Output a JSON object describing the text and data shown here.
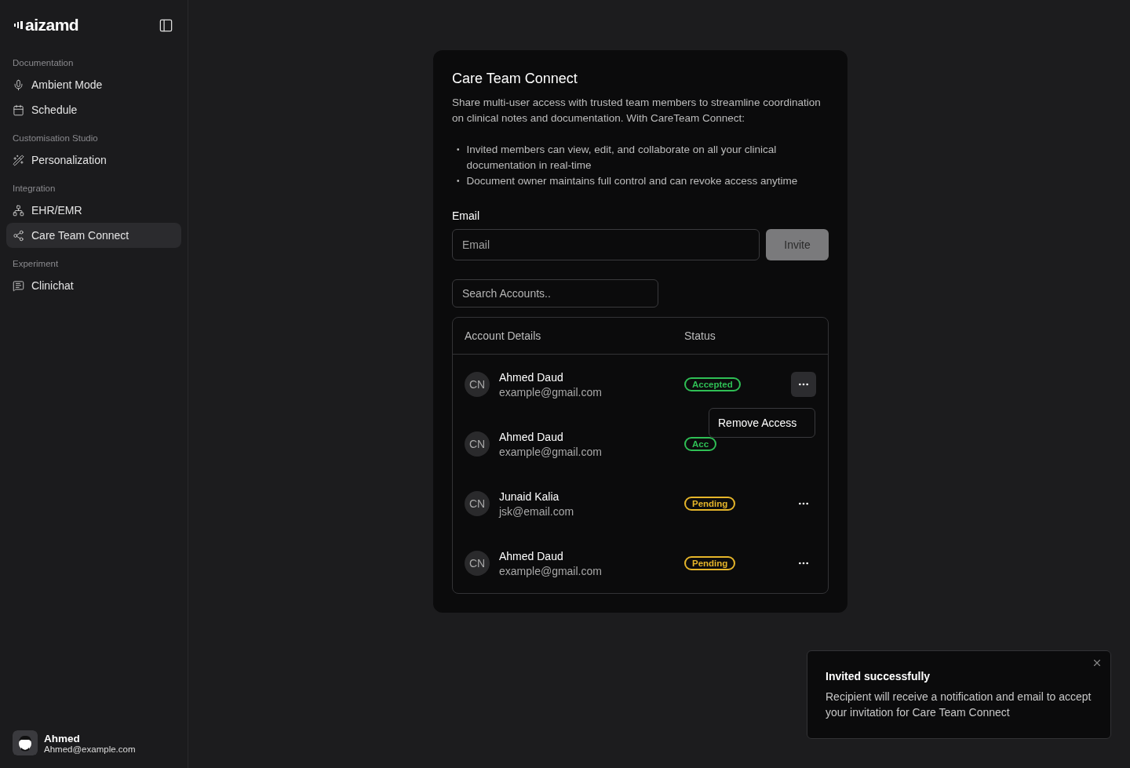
{
  "sidebar": {
    "logo": "aizamd",
    "sections": [
      {
        "title": "Documentation",
        "items": [
          {
            "label": "Ambient Mode",
            "selected": false
          },
          {
            "label": "Schedule",
            "selected": false
          }
        ]
      },
      {
        "title": "Customisation Studio",
        "items": [
          {
            "label": "Personalization",
            "selected": false
          }
        ]
      },
      {
        "title": "Integration",
        "items": [
          {
            "label": "EHR/EMR",
            "selected": false
          },
          {
            "label": "Care Team Connect",
            "selected": true
          }
        ]
      },
      {
        "title": "Experiment",
        "items": [
          {
            "label": "Clinichat",
            "selected": false
          }
        ]
      }
    ],
    "user": {
      "name": "Ahmed",
      "email": "Ahmed@example.com"
    }
  },
  "card": {
    "title": "Care Team Connect",
    "description": "Share multi-user access with trusted team members to streamline coordination on clinical notes and documentation. With CareTeam Connect:",
    "bullet_marker": "•",
    "bullets": [
      "Invited members can view, edit, and collaborate on all your clinical documentation in real-time",
      "Document owner maintains full control and can revoke access anytime"
    ],
    "email_label": "Email",
    "email_field": {
      "placeholder": "Email"
    },
    "invite_button": "Invite",
    "search": {
      "placeholder": "Search Accounts.."
    },
    "table": {
      "columns": [
        "Account Details",
        "Status"
      ],
      "rows": [
        {
          "initials": "CN",
          "name": "Ahmed Daud",
          "email": "example@gmail.com",
          "status": "Accepted",
          "kind": "accepted",
          "menu_open": true
        },
        {
          "initials": "CN",
          "name": "Ahmed Daud",
          "email": "example@gmail.com",
          "status": "Acc",
          "kind": "accepted",
          "menu_open": false
        },
        {
          "initials": "CN",
          "name": "Junaid Kalia",
          "email": "jsk@email.com",
          "status": "Pending",
          "kind": "pending",
          "menu_open": false
        },
        {
          "initials": "CN",
          "name": "Ahmed Daud",
          "email": "example@gmail.com",
          "status": "Pending",
          "kind": "pending",
          "menu_open": false
        }
      ]
    },
    "row_menu": {
      "items": [
        "Remove Access"
      ]
    }
  },
  "toast": {
    "title": "Invited successfully",
    "message": "Recipient will receive a notification and email to accept your invitation for Care Team Connect"
  }
}
